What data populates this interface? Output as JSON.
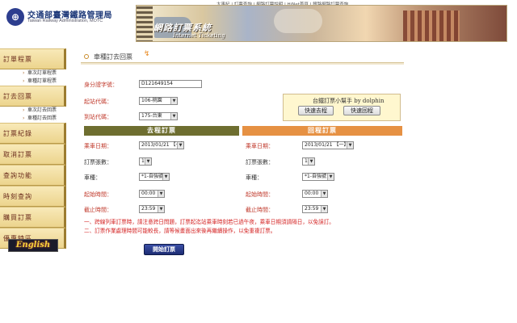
{
  "header": {
    "org_name": "交通部臺灣鐵路管理局",
    "org_name_en": "Taiwan Railway Administration, MOTC",
    "top_links": "大事紀 | 訂票查詢 | 網路訂票說明 | HiNet首頁 | 鐵路網路訂票查詢",
    "banner_title": "網路訂票系統",
    "banner_subtitle": "Internet Ticketing"
  },
  "sidebar": {
    "sections": [
      {
        "label": "訂單程票",
        "subs": [
          "車次訂單程票",
          "車種訂單程票"
        ]
      },
      {
        "label": "訂去回票",
        "subs": [
          "車次訂去回票",
          "車種訂去回票"
        ]
      },
      {
        "label": "訂票紀錄",
        "subs": []
      },
      {
        "label": "取消訂票",
        "subs": []
      },
      {
        "label": "查詢功能",
        "subs": []
      },
      {
        "label": "時刻查詢",
        "subs": []
      },
      {
        "label": "購買訂票",
        "subs": []
      },
      {
        "label": "優惠特區",
        "subs": []
      }
    ],
    "english_label": "English"
  },
  "main": {
    "title": "車種訂去回票",
    "id_label": "身分證字號：",
    "id_value": "D121649154",
    "from_label": "起站代碼：",
    "from_value": "106-桃園",
    "to_label": "到站代碼：",
    "to_value": "175-台東",
    "helper": {
      "title": "台鐵訂票小幫手 by dolphin",
      "go_btn": "快速去程",
      "back_btn": "快速回程"
    },
    "go": {
      "header": "去程訂票",
      "date_label": "乘車日期：",
      "date_value": "2013/01/21 【一】",
      "qty_label": "訂票張數：",
      "qty_value": "1",
      "type_label": "車種：",
      "type_value": "*1-自強號",
      "start_label": "起始時間：",
      "start_value": "00:00",
      "end_label": "截止時間：",
      "end_value": "23:59"
    },
    "back": {
      "header": "回程訂票",
      "date_label": "乘車日期：",
      "date_value": "2013/01/21 【一】",
      "qty_label": "訂票張數：",
      "qty_value": "1",
      "type_label": "車種：",
      "type_value": "*1-自強號",
      "start_label": "起始時間：",
      "start_value": "00:00",
      "end_label": "截止時間：",
      "end_value": "23:59"
    },
    "notes": [
      "一、跨線列車訂票時，請注意跨日問題，訂票起迄站乘車時刻若已過午夜，乘車日期須請隔日，以免誤訂。",
      "二、訂票作業處理時間可能較長，請等候畫面出來後再繼續操作，以免重複訂票。"
    ],
    "submit_label": "開始訂票"
  },
  "colors": {
    "go_header": "#6e6e30",
    "back_header": "#e69143",
    "required_label": "#c0392b",
    "notes": "#d42222",
    "submit": "#1c2b73"
  }
}
